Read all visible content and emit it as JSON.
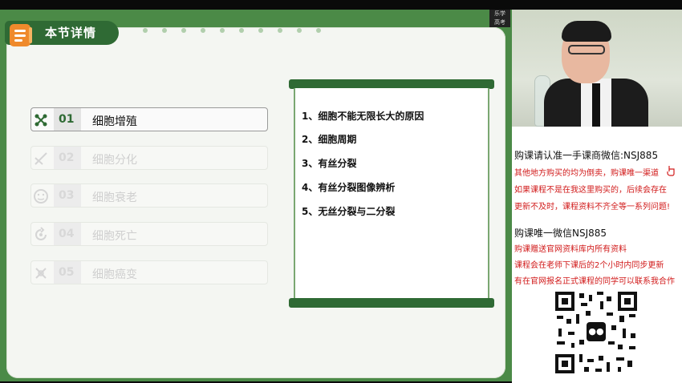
{
  "slide": {
    "header_title": "本节详情",
    "lessons": [
      {
        "num": "01",
        "label": "细胞增殖",
        "icon": "network-icon",
        "active": true
      },
      {
        "num": "02",
        "label": "细胞分化",
        "icon": "dna-icon",
        "active": false
      },
      {
        "num": "03",
        "label": "细胞衰老",
        "icon": "face-icon",
        "active": false
      },
      {
        "num": "04",
        "label": "细胞死亡",
        "icon": "cycle-icon",
        "active": false
      },
      {
        "num": "05",
        "label": "细胞癌变",
        "icon": "cell-icon",
        "active": false
      }
    ],
    "topics": [
      "1、细胞不能无限长大的原因",
      "2、细胞周期",
      "3、有丝分裂",
      "4、有丝分裂图像辨析",
      "5、无丝分裂与二分裂"
    ]
  },
  "camera": {
    "logo_top": "乐学",
    "logo_bottom": "高考"
  },
  "info": {
    "line1": "购课请认准一手课商微信:NSJ885",
    "line2": "其他地方购买的均为倒卖，购课唯一渠道",
    "line3": "如果课程不是在我这里购买的，后续会存在",
    "line4": "更新不及时，课程资料不齐全等一系列问题!",
    "line5": "购课唯一微信NSJ885",
    "line6": "购课赠送官网资料库内所有资料",
    "line7": "课程会在老师下课后的2个小时内同步更新",
    "line8": "有在官网报名正式课程的同学可以联系我合作"
  },
  "colors": {
    "slide_green": "#4b8a47",
    "dark_green": "#2f6a34",
    "info_red": "#d11a1a"
  }
}
